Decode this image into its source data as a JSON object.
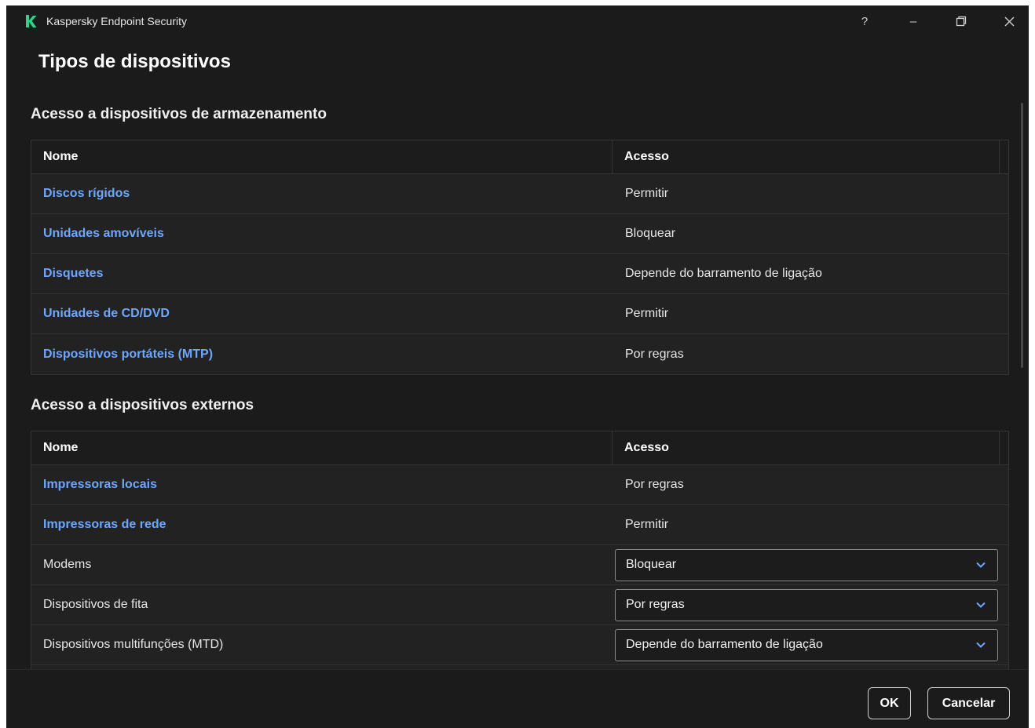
{
  "app": {
    "title": "Kaspersky Endpoint Security",
    "logo_icon": "kaspersky-logo-icon",
    "brand_color": "#2fd38a",
    "buttons": {
      "help": "?",
      "minimize": "–",
      "restore": "❐",
      "close": "✕"
    }
  },
  "page_title": "Tipos de dispositivos",
  "storage": {
    "title": "Acesso a dispositivos de armazenamento",
    "headers": {
      "name": "Nome",
      "access": "Acesso"
    },
    "rows": [
      {
        "name": "Discos rígidos",
        "access": "Permitir"
      },
      {
        "name": "Unidades amovíveis",
        "access": "Bloquear"
      },
      {
        "name": "Disquetes",
        "access": "Depende do barramento de ligação"
      },
      {
        "name": "Unidades de CD/DVD",
        "access": "Permitir"
      },
      {
        "name": "Dispositivos portáteis (MTP)",
        "access": "Por regras"
      }
    ]
  },
  "external": {
    "title": "Acesso a dispositivos externos",
    "headers": {
      "name": "Nome",
      "access": "Acesso"
    },
    "link_rows": [
      {
        "name": "Impressoras locais",
        "access": "Por regras"
      },
      {
        "name": "Impressoras de rede",
        "access": "Permitir"
      }
    ],
    "select_rows": [
      {
        "name": "Modems",
        "access": "Bloquear"
      },
      {
        "name": "Dispositivos de fita",
        "access": "Por regras"
      },
      {
        "name": "Dispositivos multifunções (MTD)",
        "access": "Depende do barramento de ligação"
      }
    ]
  },
  "footer": {
    "ok": "OK",
    "cancel": "Cancelar"
  },
  "colors": {
    "background": "#1b1b1b",
    "link": "#6ea7ff",
    "text": "#e6e6e6"
  }
}
